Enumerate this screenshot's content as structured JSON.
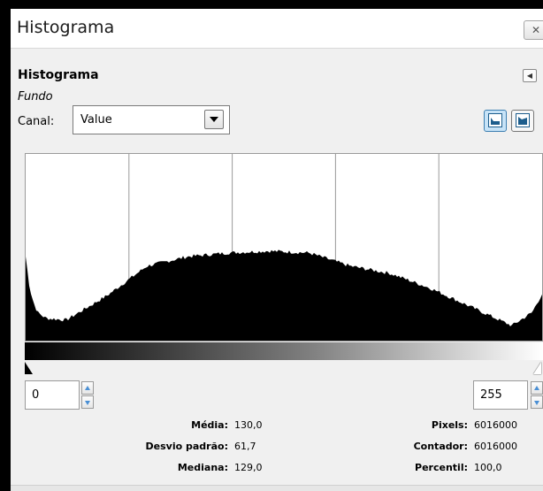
{
  "window": {
    "title": "Histograma",
    "close_icon": "close-icon"
  },
  "dock": {
    "heading": "Histograma",
    "menu_icon": "tab-menu-icon",
    "layer_name": "Fundo"
  },
  "channel": {
    "label": "Canal:",
    "selected": "Value"
  },
  "scale_buttons": [
    {
      "name": "linear-histogram-icon",
      "active": true
    },
    {
      "name": "logarithmic-histogram-icon",
      "active": false
    }
  ],
  "range": {
    "start": "0",
    "end": "255"
  },
  "stats": {
    "media_label": "Média:",
    "media_value": "130,0",
    "desvio_label": "Desvio padrão:",
    "desvio_value": "61,7",
    "mediana_label": "Mediana:",
    "mediana_value": "129,0",
    "pixels_label": "Pixels:",
    "pixels_value": "6016000",
    "contador_label": "Contador:",
    "contador_value": "6016000",
    "percentil_label": "Percentil:",
    "percentil_value": "100,0"
  },
  "chart_data": {
    "type": "area",
    "x": [
      0,
      2,
      4,
      6,
      10,
      20,
      40,
      60,
      80,
      100,
      120,
      140,
      160,
      180,
      200,
      220,
      240,
      250,
      255
    ],
    "values": [
      0.45,
      0.28,
      0.2,
      0.15,
      0.12,
      0.11,
      0.24,
      0.4,
      0.45,
      0.47,
      0.48,
      0.47,
      0.4,
      0.36,
      0.28,
      0.18,
      0.08,
      0.15,
      0.25
    ],
    "xlim": [
      0,
      255
    ],
    "ylim": [
      0,
      1
    ],
    "grid": true
  }
}
